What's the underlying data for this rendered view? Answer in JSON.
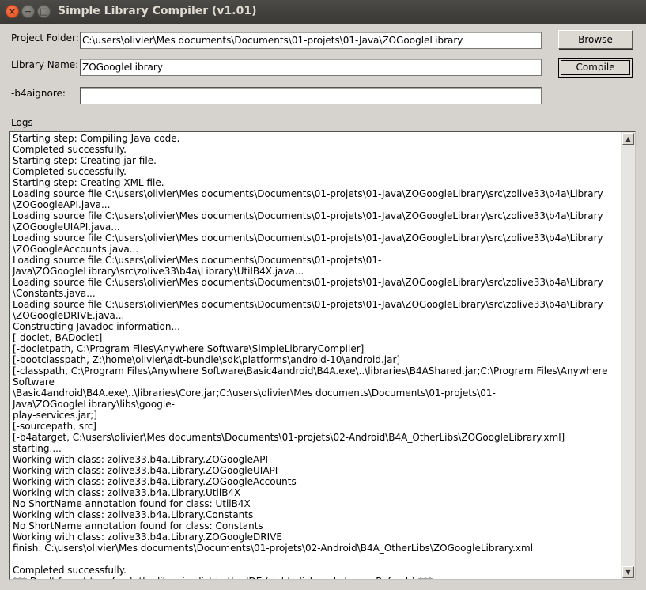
{
  "window": {
    "title": "Simple Library Compiler (v1.01)",
    "controls": {
      "close": "×",
      "minimize": "−",
      "maximize": "□"
    }
  },
  "form": {
    "project_folder_label": "Project Folder:",
    "project_folder_value": "C:\\users\\olivier\\Mes documents\\Documents\\01-projets\\01-Java\\ZOGoogleLibrary",
    "library_name_label": "Library Name:",
    "library_name_value": "ZOGoogleLibrary",
    "b4aignore_label": "-b4aignore:",
    "b4aignore_value": "",
    "browse_label": "Browse",
    "compile_label": "Compile"
  },
  "logs": {
    "label": "Logs",
    "text": "Starting step: Compiling Java code.\nCompleted successfully.\nStarting step: Creating jar file.\nCompleted successfully.\nStarting step: Creating XML file.\nLoading source file C:\\users\\olivier\\Mes documents\\Documents\\01-projets\\01-Java\\ZOGoogleLibrary\\src\\zolive33\\b4a\\Library\n\\ZOGoogleAPI.java...\nLoading source file C:\\users\\olivier\\Mes documents\\Documents\\01-projets\\01-Java\\ZOGoogleLibrary\\src\\zolive33\\b4a\\Library\n\\ZOGoogleUIAPI.java...\nLoading source file C:\\users\\olivier\\Mes documents\\Documents\\01-projets\\01-Java\\ZOGoogleLibrary\\src\\zolive33\\b4a\\Library\n\\ZOGoogleAccounts.java...\nLoading source file C:\\users\\olivier\\Mes documents\\Documents\\01-projets\\01-Java\\ZOGoogleLibrary\\src\\zolive33\\b4a\\Library\\UtilB4X.java...\nLoading source file C:\\users\\olivier\\Mes documents\\Documents\\01-projets\\01-Java\\ZOGoogleLibrary\\src\\zolive33\\b4a\\Library\n\\Constants.java...\nLoading source file C:\\users\\olivier\\Mes documents\\Documents\\01-projets\\01-Java\\ZOGoogleLibrary\\src\\zolive33\\b4a\\Library\n\\ZOGoogleDRIVE.java...\nConstructing Javadoc information...\n[-doclet, BADoclet]\n[-docletpath, C:\\Program Files\\Anywhere Software\\SimpleLibraryCompiler]\n[-bootclasspath, Z:\\home\\olivier\\adt-bundle\\sdk\\platforms\\android-10\\android.jar]\n[-classpath, C:\\Program Files\\Anywhere Software\\Basic4android\\B4A.exe\\..\\libraries\\B4AShared.jar;C:\\Program Files\\Anywhere Software\n\\Basic4android\\B4A.exe\\..\\libraries\\Core.jar;C:\\users\\olivier\\Mes documents\\Documents\\01-projets\\01-Java\\ZOGoogleLibrary\\libs\\google-\nplay-services.jar;]\n[-sourcepath, src]\n[-b4atarget, C:\\users\\olivier\\Mes documents\\Documents\\01-projets\\02-Android\\B4A_OtherLibs\\ZOGoogleLibrary.xml]\nstarting....\nWorking with class: zolive33.b4a.Library.ZOGoogleAPI\nWorking with class: zolive33.b4a.Library.ZOGoogleUIAPI\nWorking with class: zolive33.b4a.Library.ZOGoogleAccounts\nWorking with class: zolive33.b4a.Library.UtilB4X\nNo ShortName annotation found for class: UtilB4X\nWorking with class: zolive33.b4a.Library.Constants\nNo ShortName annotation found for class: Constants\nWorking with class: zolive33.b4a.Library.ZOGoogleDRIVE\nfinish: C:\\users\\olivier\\Mes documents\\Documents\\01-projets\\02-Android\\B4A_OtherLibs\\ZOGoogleLibrary.xml\n\nCompleted successfully.\n*** Don't forget to refresh the libraries list in the IDE (right click and choose Refresh) ***"
  },
  "scrollbar": {
    "up_arrow": "▲",
    "down_arrow": "▼"
  }
}
